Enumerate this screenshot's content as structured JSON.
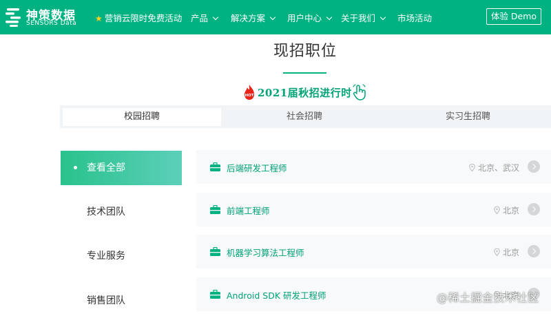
{
  "nav": {
    "logo": {
      "name": "神策数据",
      "sub": "SENSORS Data"
    },
    "items": [
      {
        "label": "营销云限时免费活动",
        "icon": "star-icon",
        "dropdown": false
      },
      {
        "label": "产品",
        "dropdown": true
      },
      {
        "label": "解决方案",
        "dropdown": true
      },
      {
        "label": "用户中心",
        "dropdown": true
      },
      {
        "label": "关于我们",
        "dropdown": true
      },
      {
        "label": "市场活动",
        "dropdown": false
      }
    ],
    "demo_button": "体验 Demo"
  },
  "page": {
    "title": "现招职位",
    "campaign": "2021届秋招进行时",
    "hot_badge": "HOT"
  },
  "tabs": [
    {
      "label": "校园招聘",
      "active": true
    },
    {
      "label": "社会招聘",
      "active": false
    },
    {
      "label": "实习生招聘",
      "active": false
    }
  ],
  "sidebar": {
    "items": [
      {
        "label": "查看全部",
        "active": true
      },
      {
        "label": "技术团队",
        "active": false
      },
      {
        "label": "专业服务",
        "active": false
      },
      {
        "label": "销售团队",
        "active": false
      }
    ]
  },
  "jobs": [
    {
      "title": "后端研发工程师",
      "location": "北京、武汉"
    },
    {
      "title": "前端工程师",
      "location": "北京"
    },
    {
      "title": "机器学习算法工程师",
      "location": "北京"
    },
    {
      "title": "Android SDK 研发工程师",
      "location": "北京"
    }
  ],
  "watermark": "@稀土掘金技术社区",
  "colors": {
    "brand": "#00b282",
    "accent_text": "#00a277",
    "hot": "#e8251b"
  }
}
